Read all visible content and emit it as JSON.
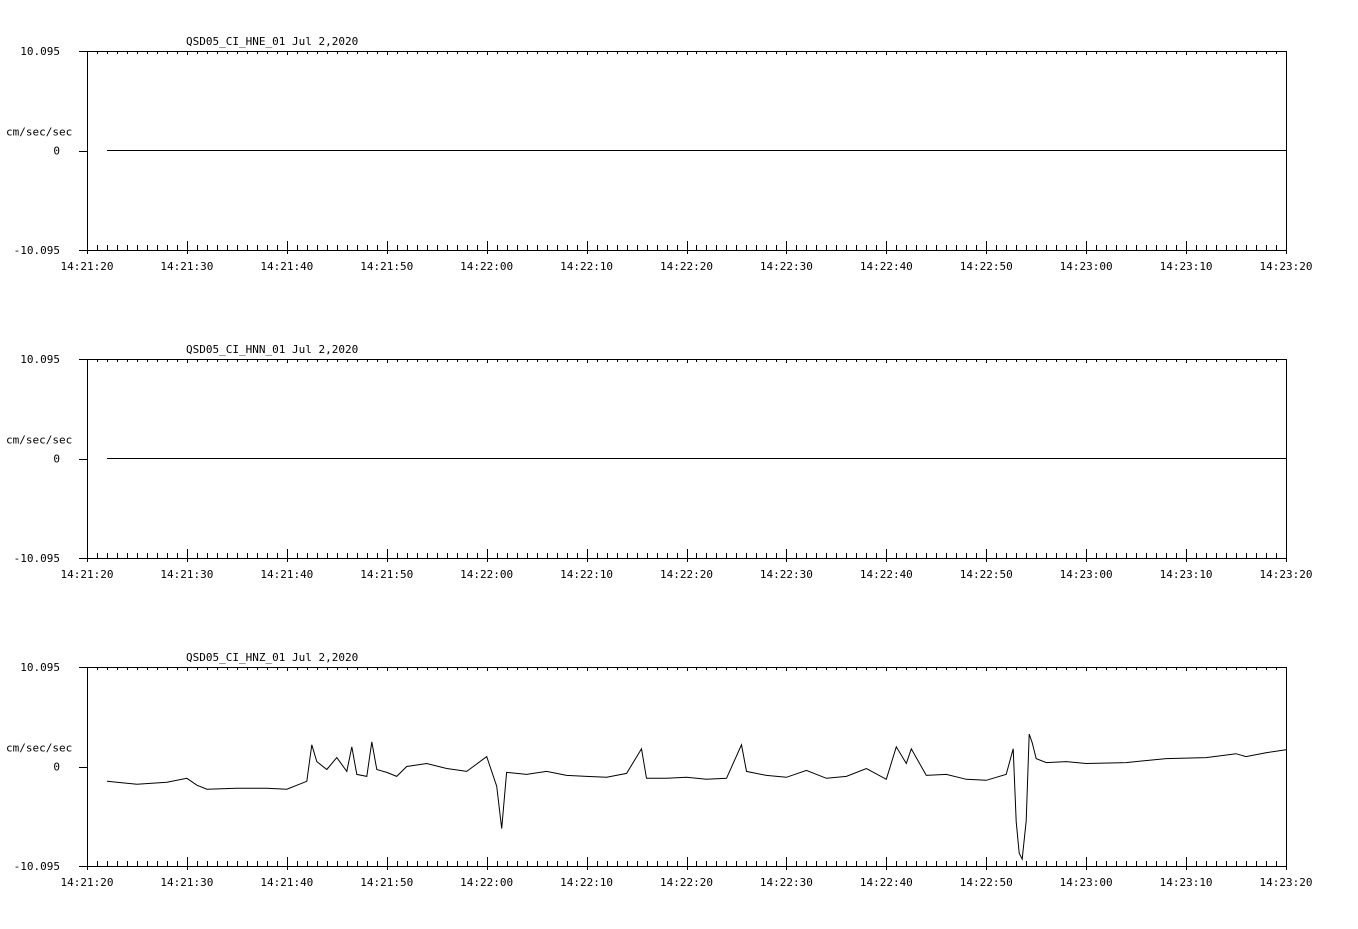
{
  "chart_data": [
    {
      "type": "line",
      "title": "QSD05_CI_HNE_01  Jul 2,2020",
      "ylabel": "cm/sec/sec",
      "ylim": [
        -10.095,
        10.095
      ],
      "y_tick_labels": [
        "10.095",
        "0",
        "-10.095"
      ],
      "x_range": [
        "14:21:20",
        "14:23:20"
      ],
      "x_tick_labels": [
        "14:21:20",
        "14:21:30",
        "14:21:40",
        "14:21:50",
        "14:22:00",
        "14:22:10",
        "14:22:20",
        "14:22:30",
        "14:22:40",
        "14:22:50",
        "14:23:00",
        "14:23:10",
        "14:23:20"
      ],
      "grid": false,
      "series": [
        {
          "x": [
            "14:21:22",
            "14:23:20"
          ],
          "y": [
            0.0,
            0.0
          ]
        }
      ]
    },
    {
      "type": "line",
      "title": "QSD05_CI_HNN_01  Jul 2,2020",
      "ylabel": "cm/sec/sec",
      "ylim": [
        -10.095,
        10.095
      ],
      "y_tick_labels": [
        "10.095",
        "0",
        "-10.095"
      ],
      "x_range": [
        "14:21:20",
        "14:23:20"
      ],
      "x_tick_labels": [
        "14:21:20",
        "14:21:30",
        "14:21:40",
        "14:21:50",
        "14:22:00",
        "14:22:10",
        "14:22:20",
        "14:22:30",
        "14:22:40",
        "14:22:50",
        "14:23:00",
        "14:23:10",
        "14:23:20"
      ],
      "grid": false,
      "series": [
        {
          "x": [
            "14:21:22",
            "14:23:20"
          ],
          "y": [
            0.0,
            0.0
          ]
        }
      ]
    },
    {
      "type": "line",
      "title": "QSD05_CI_HNZ_01  Jul 2,2020",
      "ylabel": "cm/sec/sec",
      "ylim": [
        -10.095,
        10.095
      ],
      "y_tick_labels": [
        "10.095",
        "0",
        "-10.095"
      ],
      "x_range": [
        "14:21:20",
        "14:23:20"
      ],
      "x_tick_labels": [
        "14:21:20",
        "14:21:30",
        "14:21:40",
        "14:21:50",
        "14:22:00",
        "14:22:10",
        "14:22:20",
        "14:22:30",
        "14:22:40",
        "14:22:50",
        "14:23:00",
        "14:23:10",
        "14:23:20"
      ],
      "grid": false,
      "series": [
        {
          "x": [
            "14:21:22",
            "14:21:25",
            "14:21:28",
            "14:21:30",
            "14:21:31",
            "14:21:32",
            "14:21:35",
            "14:21:38",
            "14:21:40",
            "14:21:42",
            "14:21:42.5",
            "14:21:43",
            "14:21:44",
            "14:21:45",
            "14:21:46",
            "14:21:46.5",
            "14:21:47",
            "14:21:48",
            "14:21:48.5",
            "14:21:49",
            "14:21:50",
            "14:21:51",
            "14:21:52",
            "14:21:54",
            "14:21:56",
            "14:21:58",
            "14:22:00",
            "14:22:01",
            "14:22:01.5",
            "14:22:02",
            "14:22:04",
            "14:22:06",
            "14:22:08",
            "14:22:10",
            "14:22:12",
            "14:22:14",
            "14:22:15.5",
            "14:22:16",
            "14:22:18",
            "14:22:20",
            "14:22:22",
            "14:22:24",
            "14:22:25.5",
            "14:22:26",
            "14:22:26.5",
            "14:22:28",
            "14:22:30",
            "14:22:32",
            "14:22:34",
            "14:22:36",
            "14:22:38",
            "14:22:40",
            "14:22:41",
            "14:22:42",
            "14:22:42.5",
            "14:22:44",
            "14:22:46",
            "14:22:48",
            "14:22:50",
            "14:22:52",
            "14:22:52.7",
            "14:22:53",
            "14:22:53.3",
            "14:22:53.6",
            "14:22:54",
            "14:22:54.3",
            "14:22:54.6",
            "14:22:55",
            "14:22:56",
            "14:22:58",
            "14:23:00",
            "14:23:04",
            "14:23:08",
            "14:23:12",
            "14:23:15",
            "14:23:16",
            "14:23:18",
            "14:23:20"
          ],
          "y": [
            -1.5,
            -1.8,
            -1.6,
            -1.2,
            -1.9,
            -2.3,
            -2.2,
            -2.2,
            -2.3,
            -1.5,
            2.2,
            0.5,
            -0.3,
            0.9,
            -0.5,
            2.0,
            -0.8,
            -1.0,
            2.5,
            -0.3,
            -0.6,
            -1.0,
            0.0,
            0.3,
            -0.2,
            -0.5,
            1.0,
            -2.0,
            -6.3,
            -0.6,
            -0.8,
            -0.5,
            -0.9,
            -1.0,
            -1.1,
            -0.7,
            1.8,
            -1.2,
            -1.2,
            -1.1,
            -1.3,
            -1.2,
            2.2,
            -0.5,
            -0.6,
            -0.9,
            -1.1,
            -0.4,
            -1.2,
            -1.0,
            -0.2,
            -1.3,
            2.0,
            0.3,
            1.8,
            -0.9,
            -0.8,
            -1.3,
            -1.4,
            -0.8,
            1.8,
            -5.6,
            -8.8,
            -9.4,
            -5.5,
            3.3,
            2.4,
            0.8,
            0.4,
            0.5,
            0.3,
            0.4,
            0.8,
            0.9,
            1.3,
            1.0,
            1.4,
            1.7
          ]
        }
      ]
    }
  ]
}
